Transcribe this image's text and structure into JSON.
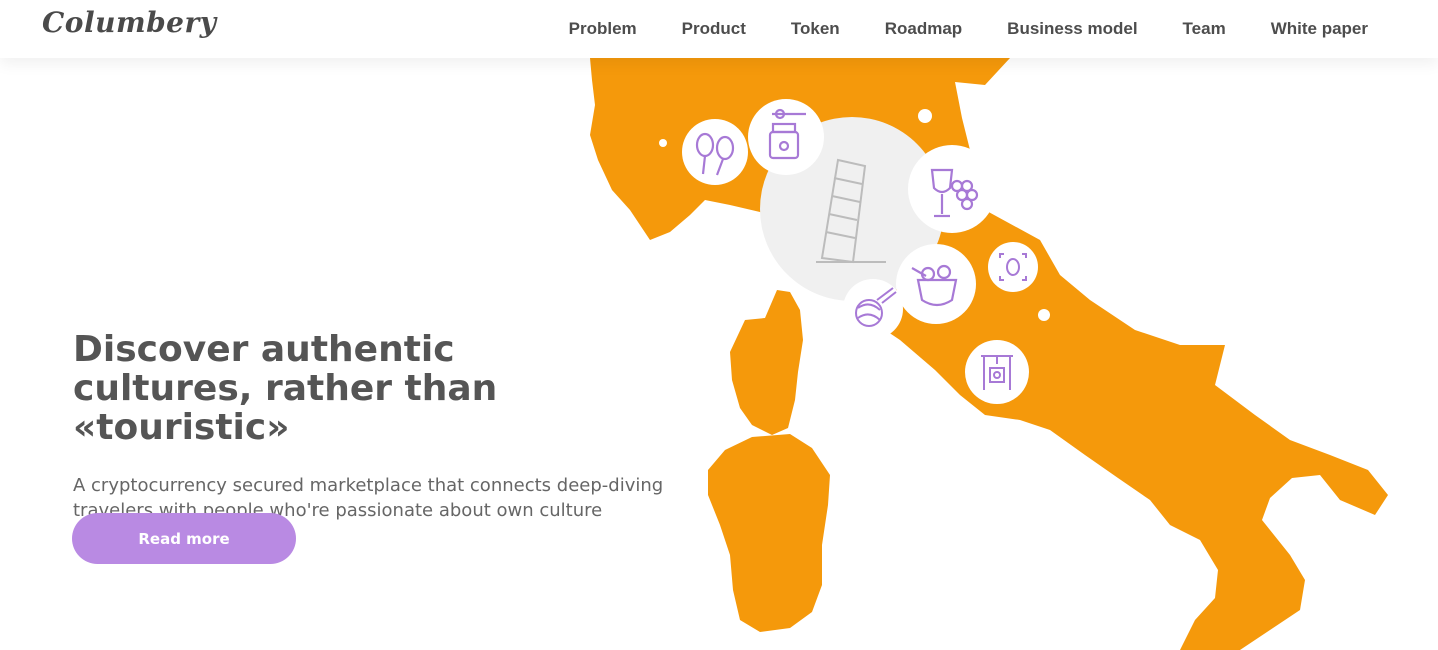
{
  "brand": {
    "logo_text": "Columbery",
    "accent_color": "#f5990b",
    "button_color": "#b98ae3"
  },
  "nav": {
    "items": [
      "Problem",
      "Product",
      "Token",
      "Roadmap",
      "Business model",
      "Team",
      "White paper"
    ]
  },
  "hero": {
    "title": "Discover authentic cultures, rather than «touristic»",
    "subtitle": "A cryptocurrency secured marketplace that connects deep-diving travelers with people who're passionate about own culture",
    "cta_label": "Read more"
  },
  "map": {
    "region": "Italy",
    "icons": [
      "leaning-tower-icon",
      "maracas-icon",
      "honey-jar-icon",
      "wine-grapes-icon",
      "focus-target-icon",
      "cooking-pot-icon",
      "yarn-ball-icon",
      "bbq-grill-icon"
    ]
  }
}
